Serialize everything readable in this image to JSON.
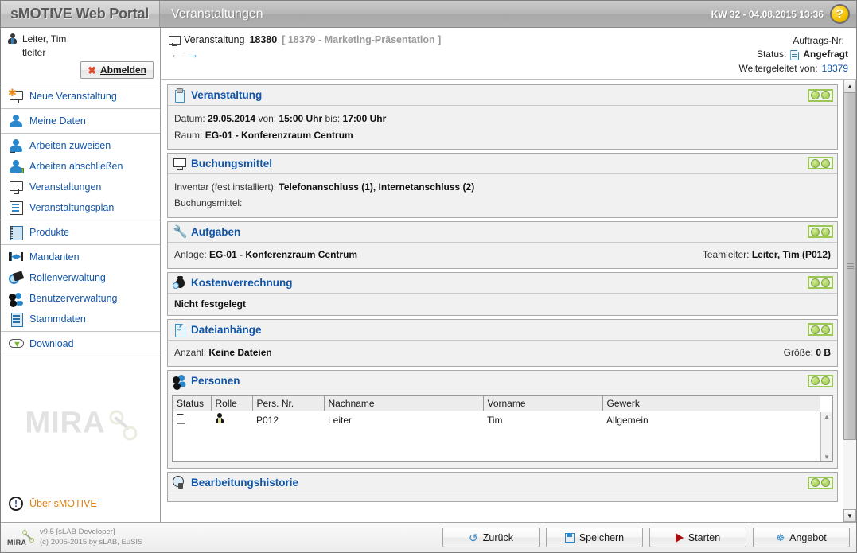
{
  "header": {
    "brand": "sMOTIVE Web Portal",
    "module_title": "Veranstaltungen",
    "kw_datetime": "KW 32 - 04.08.2015 13:36",
    "help_label": "?"
  },
  "sidebar": {
    "user": {
      "display_name": "Leiter, Tim",
      "username": "tleiter",
      "logout_label": "Abmelden"
    },
    "groups": [
      {
        "items": [
          {
            "label": "Neue Veranstaltung",
            "icon": "new-event-icon"
          }
        ]
      },
      {
        "items": [
          {
            "label": "Meine Daten",
            "icon": "person-icon"
          }
        ]
      },
      {
        "items": [
          {
            "label": "Arbeiten zuweisen",
            "icon": "assign-work-icon"
          },
          {
            "label": "Arbeiten abschließen",
            "icon": "complete-work-icon"
          },
          {
            "label": "Veranstaltungen",
            "icon": "monitor-icon"
          },
          {
            "label": "Veranstaltungsplan",
            "icon": "plan-icon"
          }
        ]
      },
      {
        "items": [
          {
            "label": "Produkte",
            "icon": "products-icon"
          }
        ]
      },
      {
        "items": [
          {
            "label": "Mandanten",
            "icon": "clients-icon"
          },
          {
            "label": "Rollenverwaltung",
            "icon": "roles-icon"
          },
          {
            "label": "Benutzerverwaltung",
            "icon": "users-icon"
          },
          {
            "label": "Stammdaten",
            "icon": "master-data-icon"
          }
        ]
      },
      {
        "items": [
          {
            "label": "Download",
            "icon": "download-cloud-icon"
          }
        ]
      }
    ],
    "watermark": "MIRA",
    "about_label": "Über sMOTIVE"
  },
  "breadcrumb": {
    "entity_label": "Veranstaltung",
    "entity_number": "18380",
    "parent_ref": "[ 18379 - Marketing-Präsentation ]",
    "back_arrow": "←",
    "forward_arrow": "→"
  },
  "meta": {
    "order_no_label": "Auftrags-Nr:",
    "order_no_value": "",
    "status_label": "Status:",
    "status_value": "Angefragt",
    "forwarded_label": "Weitergeleitet von:",
    "forwarded_value": "18379"
  },
  "panels": [
    {
      "id": "veranstaltung",
      "title": "Veranstaltung",
      "icon": "clipboard-icon",
      "rows": [
        {
          "segments": [
            {
              "label": "Datum:",
              "value": "29.05.2014"
            },
            {
              "label": "von:",
              "value": "15:00 Uhr"
            },
            {
              "label": "bis:",
              "value": "17:00 Uhr"
            }
          ]
        },
        {
          "segments": [
            {
              "label": "Raum:",
              "value": "EG-01 - Konferenzraum Centrum"
            }
          ]
        }
      ]
    },
    {
      "id": "buchungsmittel",
      "title": "Buchungsmittel",
      "icon": "projector-icon",
      "rows": [
        {
          "segments": [
            {
              "label": "Inventar (fest installiert):",
              "value": "Telefonanschluss (1), Internetanschluss (2)"
            }
          ]
        },
        {
          "segments": [
            {
              "label": "Buchungsmittel:",
              "value": ""
            }
          ]
        }
      ]
    },
    {
      "id": "aufgaben",
      "title": "Aufgaben",
      "icon": "wrench-icon",
      "left": {
        "label": "Anlage:",
        "value": "EG-01 - Konferenzraum Centrum"
      },
      "right": {
        "label": "Teamleiter:",
        "value": "Leiter, Tim (P012)"
      }
    },
    {
      "id": "kostenverrechnung",
      "title": "Kostenverrechnung",
      "icon": "money-bag-icon",
      "single_value": "Nicht festgelegt"
    },
    {
      "id": "dateianhaenge",
      "title": "Dateianhänge",
      "icon": "file-attachment-icon",
      "left": {
        "label": "Anzahl:",
        "value": "Keine Dateien"
      },
      "right": {
        "label": "Größe:",
        "value": "0 B"
      }
    },
    {
      "id": "personen",
      "title": "Personen",
      "icon": "people-icon"
    },
    {
      "id": "bearbeitungshistorie",
      "title": "Bearbeitungshistorie",
      "icon": "history-icon"
    }
  ],
  "personen_table": {
    "columns": [
      "Status",
      "Rolle",
      "Pers. Nr.",
      "Nachname",
      "Vorname",
      "Gewerk"
    ],
    "rows": [
      {
        "status_icon": "document-icon",
        "role_icon": "person-role-icon",
        "pers_nr": "P012",
        "nachname": "Leiter",
        "vorname": "Tim",
        "gewerk": "Allgemein"
      }
    ]
  },
  "footer": {
    "logo_text": "MIRA",
    "version": "v9.5 [sLAB Developer]",
    "copyright": "(c) 2005-2015 by sLAB, EuSIS",
    "buttons": [
      {
        "label": "Zurück",
        "icon": "undo-icon"
      },
      {
        "label": "Speichern",
        "icon": "save-icon"
      },
      {
        "label": "Starten",
        "icon": "play-icon"
      },
      {
        "label": "Angebot",
        "icon": "offer-icon"
      }
    ]
  },
  "colors": {
    "link": "#1155a8",
    "accent_blue": "#2b87c9",
    "toggle_green": "#9cc755",
    "about_orange": "#d9821a",
    "status_bold": "#111111"
  }
}
